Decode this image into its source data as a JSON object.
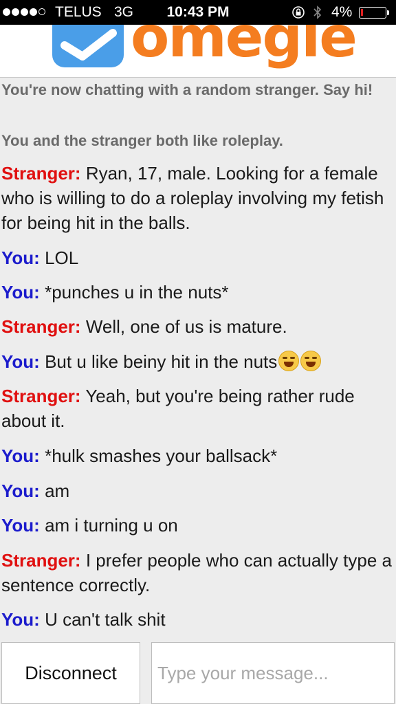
{
  "status_bar": {
    "carrier": "TELUS",
    "network": "3G",
    "time": "10:43 PM",
    "battery": "4%",
    "battery_level": 0.04,
    "signal_bars_filled": 4,
    "signal_bars_total": 5,
    "icons": [
      "rotation-lock-icon",
      "bluetooth-icon",
      "battery-icon"
    ]
  },
  "header": {
    "brand": "omegle",
    "brand_color": "#f47d20",
    "icon_color": "#4a9ee8"
  },
  "chat": {
    "system_messages": [
      "You're now chatting with a random stranger. Say hi!",
      "You and the stranger both like roleplay."
    ],
    "messages": [
      {
        "sender": "Stranger:",
        "text": "Ryan, 17, male. Looking for a female who is willing to do a roleplay involving my fetish for being hit in the balls."
      },
      {
        "sender": "You:",
        "text": "LOL"
      },
      {
        "sender": "You:",
        "text": "*punches u in the nuts*"
      },
      {
        "sender": "Stranger:",
        "text": "Well, one of us is mature."
      },
      {
        "sender": "You:",
        "text": "But u like beiny hit in the nuts"
      },
      {
        "sender": "Stranger:",
        "text": "Yeah, but you're being rather rude about it."
      },
      {
        "sender": "You:",
        "text": "*hulk smashes your ballsack*"
      },
      {
        "sender": "You:",
        "text": "am"
      },
      {
        "sender": "You:",
        "text": "am i turning u on"
      },
      {
        "sender": "Stranger:",
        "text": "I prefer people who can actually type a sentence correctly."
      },
      {
        "sender": "You:",
        "text": "U can't talk shit"
      }
    ],
    "stranger_color": "#e01010",
    "you_color": "#1c1ccc"
  },
  "bottom_bar": {
    "disconnect_label": "Disconnect",
    "message_placeholder": "Type your message..."
  }
}
